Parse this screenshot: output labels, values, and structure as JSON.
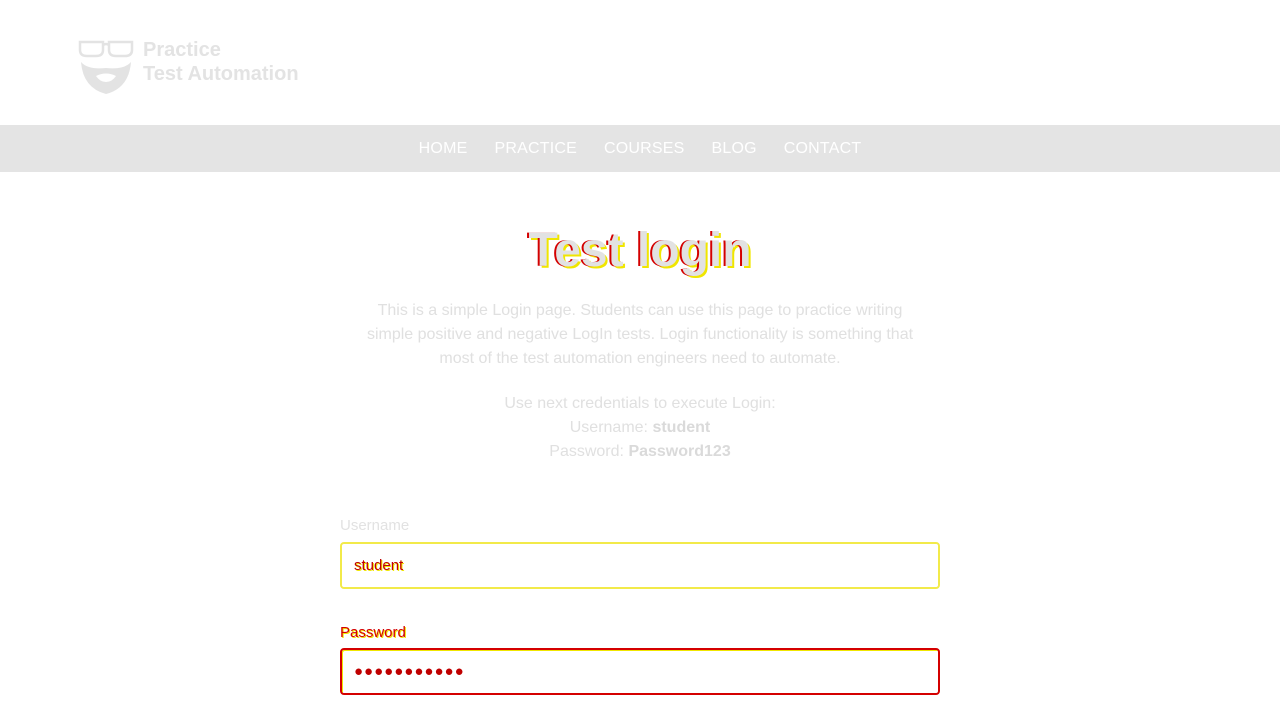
{
  "logo": {
    "line1": "Practice",
    "line2": "Test Automation",
    "icon": "bearded-glasses-face-icon"
  },
  "nav": {
    "items": [
      {
        "label": "HOME"
      },
      {
        "label": "PRACTICE"
      },
      {
        "label": "COURSES"
      },
      {
        "label": "BLOG"
      },
      {
        "label": "CONTACT"
      }
    ]
  },
  "page": {
    "title": "Test login",
    "description": "This is a simple Login page. Students can use this page to practice writing simple positive and negative LogIn tests. Login functionality is something that most of the test automation engineers need to automate.",
    "credentials_intro": "Use next credentials to execute Login:",
    "username_prefix": "Username:",
    "username_value": "student",
    "password_prefix": "Password:",
    "password_value": "Password123"
  },
  "form": {
    "username_label": "Username",
    "username_value": "student",
    "password_label": "Password",
    "password_value": "●●●●●●●●●●●"
  },
  "colors": {
    "nav_bg": "#e4e4e4",
    "error": "#d40000",
    "focus": "#f0e600"
  }
}
